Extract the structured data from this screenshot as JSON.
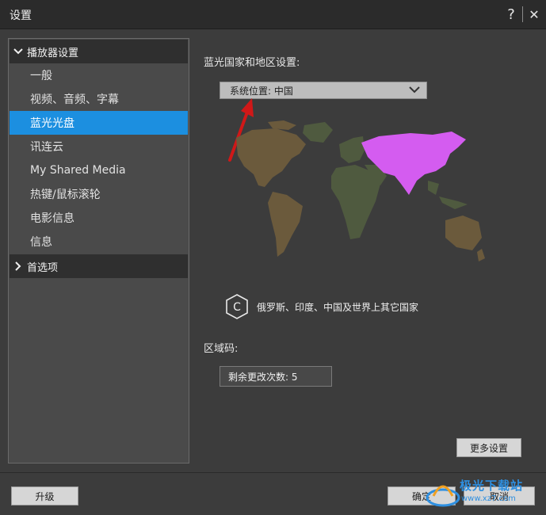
{
  "window": {
    "title": "设置",
    "help_label": "?",
    "close_label": "✕"
  },
  "sidebar": {
    "group1": {
      "label": "播放器设置",
      "expanded": true
    },
    "items": [
      {
        "label": "一般"
      },
      {
        "label": "视频、音频、字幕"
      },
      {
        "label": "蓝光光盘",
        "selected": true
      },
      {
        "label": "讯连云"
      },
      {
        "label": "My Shared Media"
      },
      {
        "label": "热键/鼠标滚轮"
      },
      {
        "label": "电影信息"
      },
      {
        "label": "信息"
      }
    ],
    "group2": {
      "label": "首选项",
      "expanded": false
    }
  },
  "main": {
    "country_label": "蓝光国家和地区设置:",
    "country_select": {
      "value": "系统位置: 中国"
    },
    "region": {
      "letter": "C",
      "description": "俄罗斯、印度、中国及世界上其它国家"
    },
    "region_code_label": "区域码:",
    "remaining_changes": "剩余更改次数:  5",
    "more_settings": "更多设置"
  },
  "footer": {
    "upgrade": "升级",
    "ok": "确定",
    "cancel": "取消"
  },
  "watermark": {
    "text": "极光下载站",
    "url": "www.xz7.com"
  },
  "colors": {
    "selected": "#1c8fe0",
    "region_c": "#d45cf0",
    "map_brown": "#6b5a3c",
    "map_green": "#4f5a3f",
    "arrow": "#d01818"
  }
}
